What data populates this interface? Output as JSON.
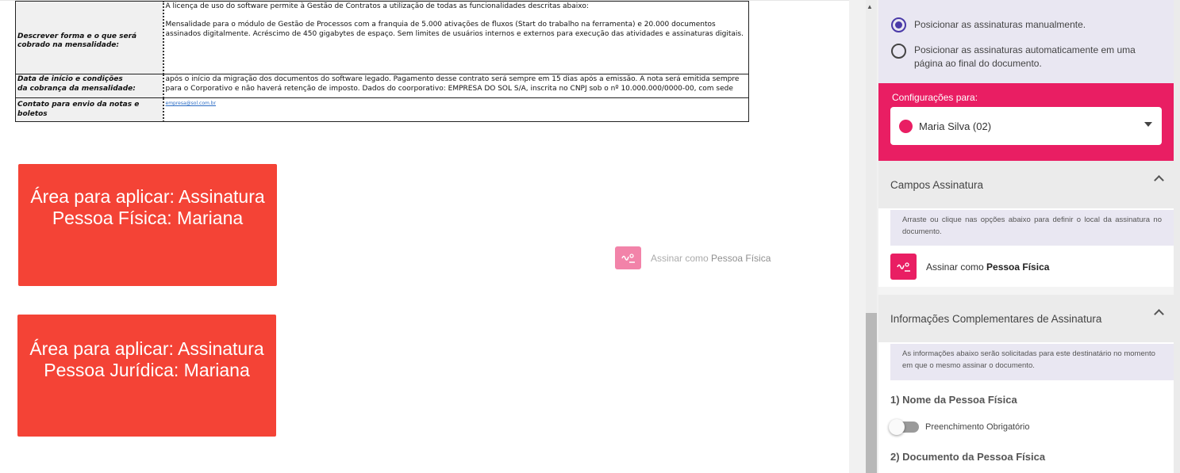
{
  "document": {
    "rows": [
      {
        "label": "Descrever forma e o que será cobrado na mensalidade:",
        "value_lines": [
          "A licença de uso do software permite à Gestão de Contratos a utilização de todas as funcionalidades descritas abaixo:",
          "",
          "Mensalidade para o módulo de Gestão de Processos com a franquia de 5.000 ativações de fluxos (Start do trabalho na ferramenta) e 20.000 documentos",
          "assinados digitalmente. Acréscimo de 450 gigabytes de espaço. Sem limites de usuários internos e externos para execução das atividades e assinaturas digitais."
        ]
      },
      {
        "label_lines": [
          "Data de início e condições",
          "da cobrança da mensalidade:"
        ],
        "value_lines": [
          "após o início da migração dos documentos do software legado.  Pagamento desse contrato será sempre em 15 dias após a emissão. A nota será emitida sempre",
          "para o Corporativo e não haverá retenção de imposto. Dados do coorporativo: EMPRESA DO SOL S/A, inscrita no CNPJ sob o nº 10.000.000/0000-00, com sede"
        ]
      },
      {
        "label": "Contato para envio da notas e boletos",
        "value": "empresa@sol.com.br"
      }
    ],
    "areas": [
      {
        "line1": "Área para aplicar: Assinatura",
        "line2": "Pessoa Física: Mariana"
      },
      {
        "line1": "Área para aplicar: Assinatura",
        "line2": "Pessoa Jurídica: Mariana"
      }
    ],
    "drag_preview": {
      "prefix": "Assinar como ",
      "bold": "Pessoa Física",
      "icon": "signature-icon"
    }
  },
  "panel": {
    "positioning": {
      "manual": "Posicionar as assinaturas manualmente.",
      "auto": "Posicionar as assinaturas automaticamente em uma página ao final do documento.",
      "selected": "manual"
    },
    "config": {
      "label": "Configurações para:",
      "selected": "Maria Silva (02)",
      "dot_color": "#e91e63"
    },
    "signature_fields": {
      "title": "Campos Assinatura",
      "hint": "Arraste ou clique nas opções abaixo para definir o local da assinatura no documento.",
      "option_prefix": "Assinar como ",
      "option_bold": "Pessoa Física",
      "icon": "signature-icon"
    },
    "complementary": {
      "title": "Informações Complementares de Assinatura",
      "hint": "As informações abaixo serão solicitadas para este destinatário no momento em que o mesmo assinar o documento.",
      "q1": "1) Nome da Pessoa Física",
      "required_label": "Preenchimento Obrigatório",
      "required_on": false,
      "q2": "2) Documento da Pessoa Física"
    }
  },
  "colors": {
    "accent": "#e91e63",
    "area_red": "#f44336",
    "radio_purple": "#4a3aa8",
    "panel_lavender": "#e9e7f2"
  }
}
